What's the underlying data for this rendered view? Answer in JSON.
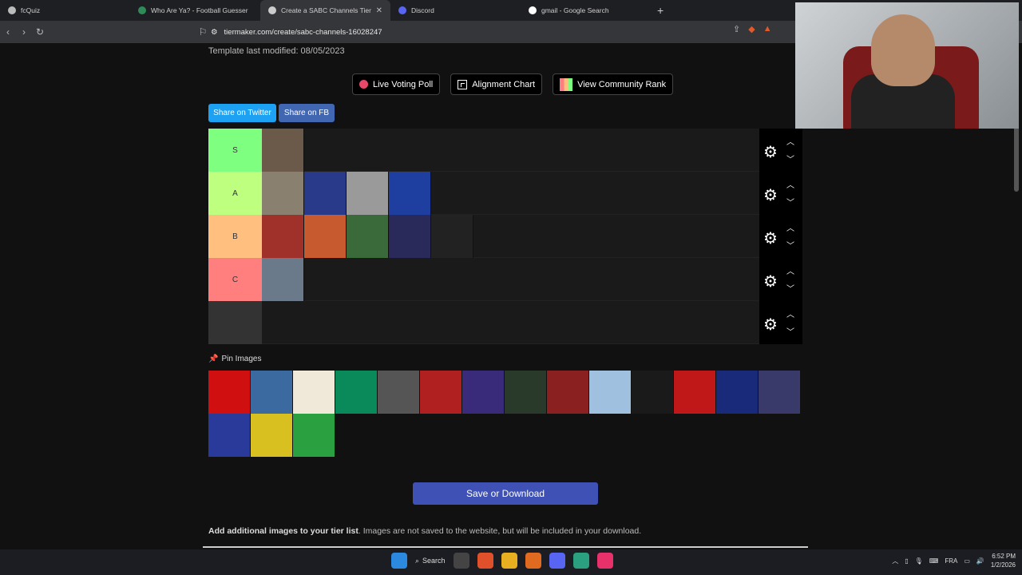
{
  "browser": {
    "tabs": [
      {
        "title": "fcQuiz",
        "color": "#bbbbbb",
        "active": false
      },
      {
        "title": "Who Are Ya? - Football Guesser",
        "color": "#2e8b57",
        "active": false
      },
      {
        "title": "Create a SABC Channels Tier List",
        "color": "#cccccc",
        "active": true
      },
      {
        "title": "Discord",
        "color": "#5865f2",
        "active": false
      },
      {
        "title": "gmail - Google Search",
        "color": "#ffffff",
        "active": false
      }
    ],
    "close_tab": "✕",
    "new_tab": "+",
    "url": "tiermaker.com/create/sabc-channels-16028247"
  },
  "page": {
    "modified": "Template last modified: 08/05/2023",
    "buttons": {
      "poll": "Live Voting Poll",
      "alignment": "Alignment Chart",
      "community": "View Community Rank"
    },
    "share_twitter": "Share on Twitter",
    "share_fb": "Share on FB",
    "tiers": [
      {
        "label": "S",
        "color": "#7fff7f",
        "items": [
          "#6b5a4a"
        ]
      },
      {
        "label": "A",
        "color": "#bfff7f",
        "items": [
          "#8a8070",
          "#2a3a8a",
          "#9a9a9a",
          "#1f3fa0"
        ]
      },
      {
        "label": "B",
        "color": "#ffbf7f",
        "items": [
          "#a0302a",
          "#c85a30",
          "#3a6a3a",
          "#2a2a5a",
          "#222222"
        ]
      },
      {
        "label": "C",
        "color": "#ff7f7f",
        "items": [
          "#6a7a8a"
        ]
      },
      {
        "label": "",
        "color": "#333333",
        "items": []
      }
    ],
    "pin_label": "Pin Images",
    "pool": [
      "#d01010",
      "#3a6aa0",
      "#f0e8d8",
      "#0a8a5a",
      "#555555",
      "#b02020",
      "#3a2a7a",
      "#2a3a2a",
      "#8a2020",
      "#a0c0e0",
      "#1a1a1a",
      "#c01818",
      "#1a2a7a",
      "#3a3a6a",
      "#2a3a9a",
      "#d8c020",
      "#2aa040"
    ],
    "save": "Save or Download",
    "add_bold": "Add additional images to your tier list",
    "add_rest": ". Images are not saved to the website, but will be included in your download."
  },
  "taskbar": {
    "search": "Search",
    "lang": "FRA",
    "time": "6:52 PM",
    "date": "1/2/2026"
  }
}
